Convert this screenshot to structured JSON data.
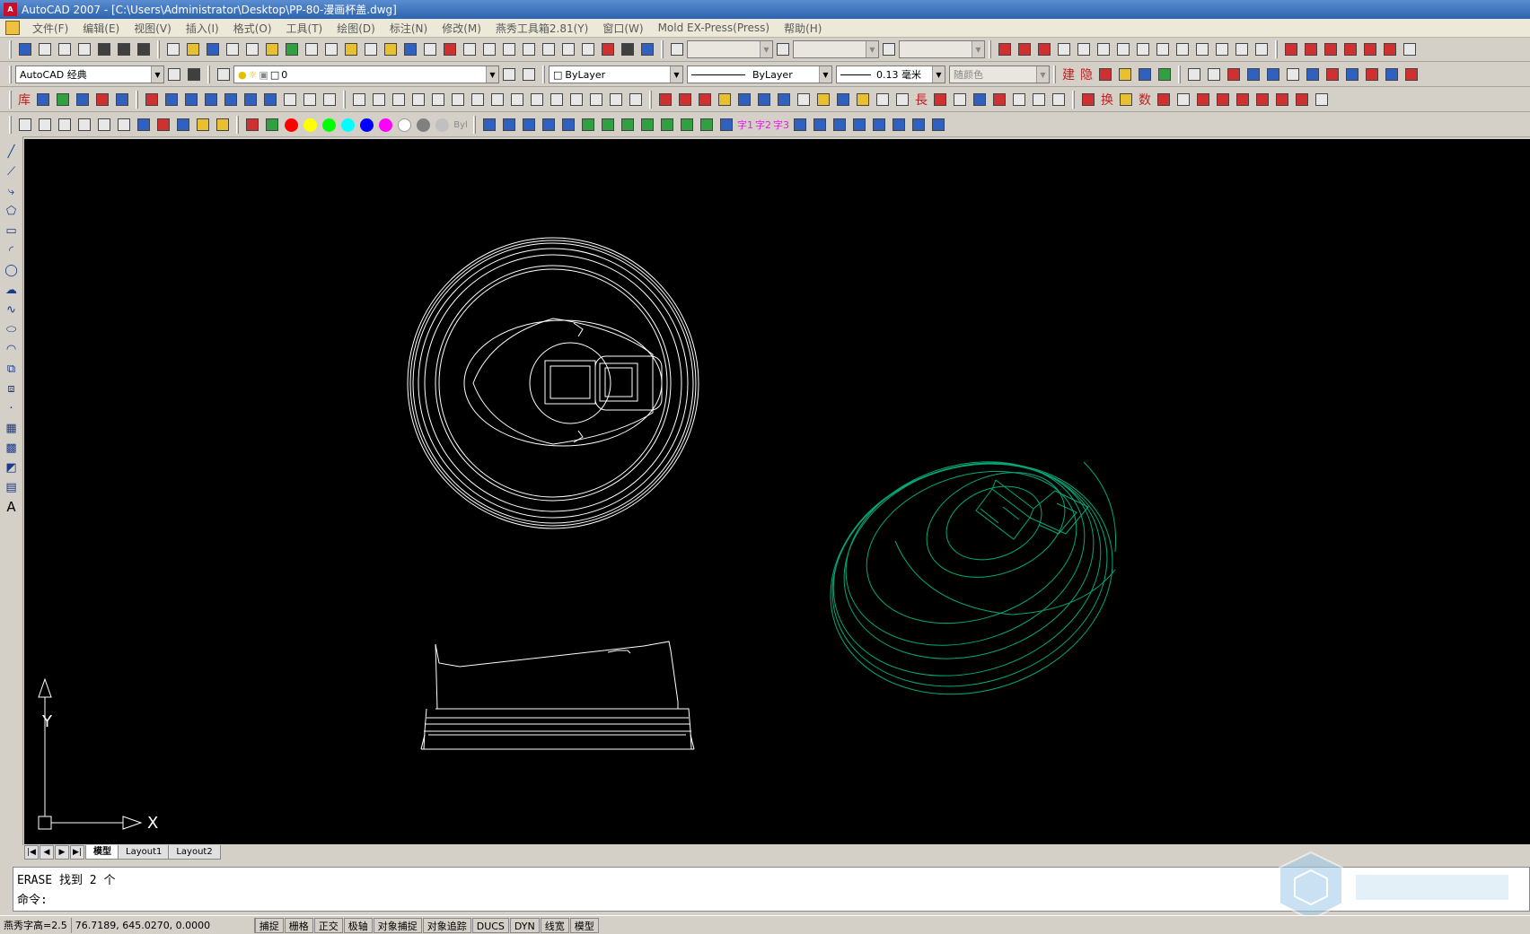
{
  "title": "AutoCAD 2007 - [C:\\Users\\Administrator\\Desktop\\PP-80-漫画杯盖.dwg]",
  "menu": [
    "文件(F)",
    "编辑(E)",
    "视图(V)",
    "插入(I)",
    "格式(O)",
    "工具(T)",
    "绘图(D)",
    "标注(N)",
    "修改(M)",
    "燕秀工具箱2.81(Y)",
    "窗口(W)",
    "Mold EX-Press(Press)",
    "帮助(H)"
  ],
  "toolbar": {
    "workspace": "AutoCAD 经典",
    "layer": "0",
    "color": "ByLayer",
    "linetype": "ByLayer",
    "lineweight": "0.13 毫米",
    "plotstyle": "随颜色",
    "text_row": [
      "库",
      "建",
      "隐",
      "换",
      "数",
      "字1",
      "字2",
      "字3",
      "Byl"
    ]
  },
  "palette_colors": [
    "#ff0000",
    "#ffff00",
    "#00ff00",
    "#00ffff",
    "#0000ff",
    "#ff00ff",
    "#ffffff",
    "#808080",
    "#c0c0c0"
  ],
  "axis": {
    "x_label": "X",
    "y_label": "Y"
  },
  "tabs": [
    "模型",
    "Layout1",
    "Layout2"
  ],
  "command": {
    "line1": "ERASE 找到 2 个",
    "line2": "命令:"
  },
  "status": {
    "font_height": "燕秀字高=2.5",
    "coords": "76.7189,  645.0270, 0.0000",
    "toggles": [
      "捕捉",
      "栅格",
      "正交",
      "极轴",
      "对象捕捉",
      "对象追踪",
      "DUCS",
      "DYN",
      "线宽",
      "模型"
    ]
  },
  "colors": {
    "drawing_white": "#ffffff",
    "drawing_green": "#00a878",
    "background": "#000000"
  }
}
